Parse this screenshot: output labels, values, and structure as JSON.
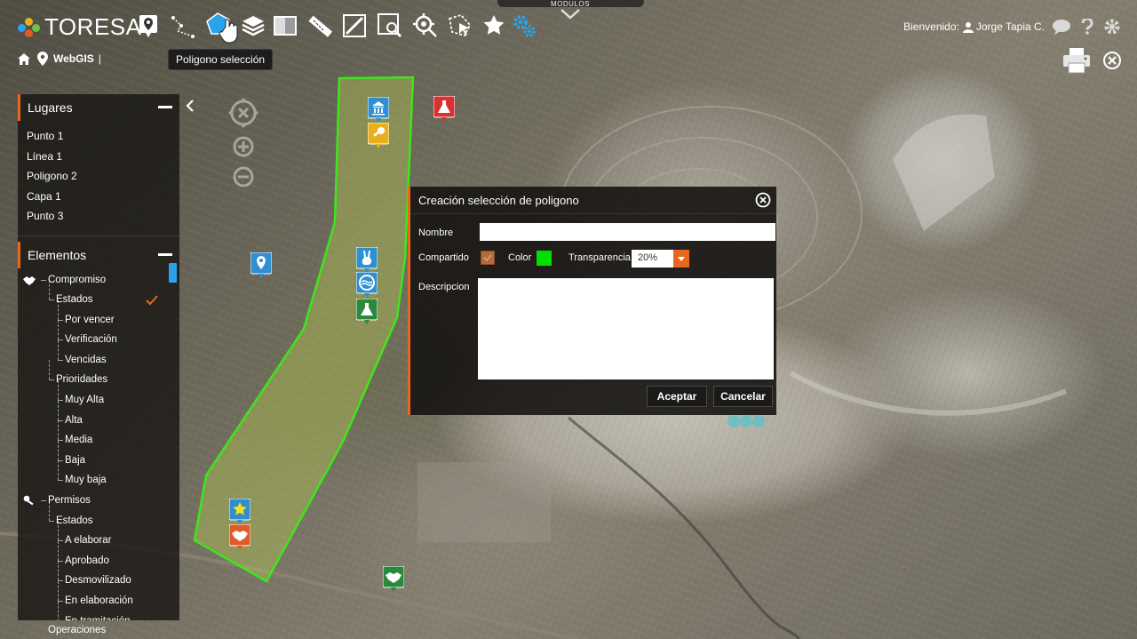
{
  "app": {
    "logo_text": "TORESA",
    "modules_label": "MODULOS"
  },
  "toolbar": {
    "tools": [
      "point-tool",
      "line-tool",
      "polygon-selection-tool",
      "layers-tool",
      "split-view-tool",
      "ruler-tool",
      "measure-area-tool",
      "zoom-area-tool",
      "locate-tool",
      "select-area-tool",
      "favorites-tool",
      "settings-tool"
    ],
    "tooltip": "Poligono selección"
  },
  "user": {
    "greeting": "Bienvenido:",
    "name": "Jorge Tapia C."
  },
  "breadcrumb": {
    "label": "WebGIS",
    "separator": "|"
  },
  "panel": {
    "places_title": "Lugares",
    "places": [
      "Punto 1",
      "Línea 1",
      "Poligono 2",
      "Capa 1",
      "Punto 3"
    ],
    "elements_title": "Elementos",
    "tree": [
      {
        "label": "Compromiso",
        "level": 0,
        "icon": "handshake-icon",
        "checked": false
      },
      {
        "label": "Estados",
        "level": 1,
        "checked": true
      },
      {
        "label": "Por vencer",
        "level": 2
      },
      {
        "label": "Verificación",
        "level": 2
      },
      {
        "label": "Vencidas",
        "level": 2
      },
      {
        "label": "Prioridades",
        "level": 1
      },
      {
        "label": "Muy Alta",
        "level": 2
      },
      {
        "label": "Alta",
        "level": 2
      },
      {
        "label": "Media",
        "level": 2
      },
      {
        "label": "Baja",
        "level": 2
      },
      {
        "label": "Muy baja",
        "level": 2
      },
      {
        "label": "Permisos",
        "level": 0,
        "icon": "key-icon"
      },
      {
        "label": "Estados",
        "level": 1
      },
      {
        "label": "A elaborar",
        "level": 2
      },
      {
        "label": "Aprobado",
        "level": 2
      },
      {
        "label": "Desmovilizado",
        "level": 2
      },
      {
        "label": "En elaboración",
        "level": 2
      },
      {
        "label": "En tramitación",
        "level": 2
      }
    ],
    "overflow_label": "Operaciones"
  },
  "dialog": {
    "title": "Creación selección de poligono",
    "name_label": "Nombre",
    "name_value": "",
    "shared_label": "Compartido",
    "color_label": "Color",
    "color_value": "#00e000",
    "transparency_label": "Transparencia",
    "transparency_value": "20%",
    "description_label": "Descripcion",
    "description_value": "",
    "accept_label": "Aceptar",
    "cancel_label": "Cancelar"
  },
  "map": {
    "polygon_color": "#3ee61a",
    "markers": [
      {
        "name": "museum-marker",
        "icon": "bank-icon",
        "color": "#2f8fd0"
      },
      {
        "name": "permit-marker",
        "icon": "key-icon",
        "color": "#e8b01c"
      },
      {
        "name": "lab-marker-red",
        "icon": "flask-icon",
        "color": "#d93030"
      },
      {
        "name": "location-marker",
        "icon": "pin-icon",
        "color": "#2f8fd0"
      },
      {
        "name": "fauna-marker",
        "icon": "rabbit-icon",
        "color": "#2f8fd0"
      },
      {
        "name": "water-marker",
        "icon": "water-icon",
        "color": "#2f8fd0"
      },
      {
        "name": "lab-marker-green",
        "icon": "flask-icon",
        "color": "#2a8a3a"
      },
      {
        "name": "favorite-marker",
        "icon": "star-icon",
        "color": "#2f8fd0"
      },
      {
        "name": "commitment-marker-red",
        "icon": "handshake-icon",
        "color": "#e05a2a"
      },
      {
        "name": "commitment-marker-green",
        "icon": "handshake-icon",
        "color": "#2a8a3a"
      }
    ]
  },
  "colors": {
    "accent": "#e8671e",
    "active_blue": "#2aa3ec",
    "panel_bg": "#191614"
  }
}
